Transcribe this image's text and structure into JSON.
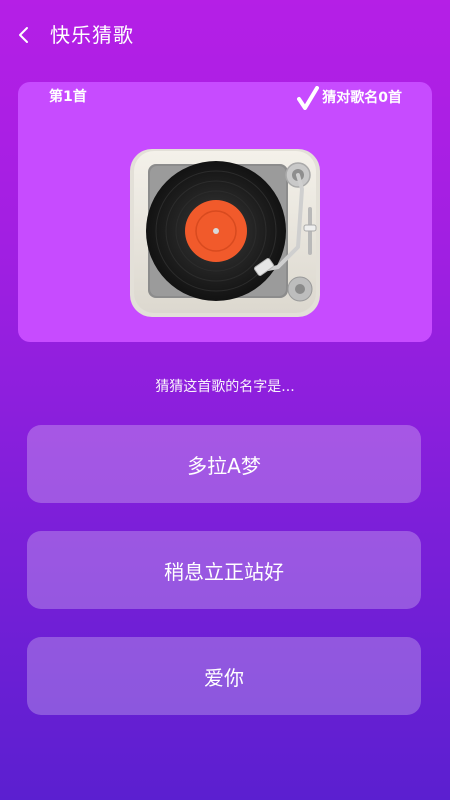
{
  "header": {
    "title": "快乐猜歌",
    "back_icon": "chevron-left-icon"
  },
  "card": {
    "song_index": "第1首",
    "correct_count": "猜对歌名0首",
    "check_icon": "checkmark-icon",
    "art_icon": "turntable-icon"
  },
  "prompt": "猜猜这首歌的名字是...",
  "options": [
    {
      "label": "多拉A梦"
    },
    {
      "label": "稍息立正站好"
    },
    {
      "label": "爱你"
    }
  ],
  "colors": {
    "background_top": "#b51fe6",
    "background_bottom": "#5b1fd0",
    "card": "#c74bff",
    "record_label": "#f15a2b"
  }
}
